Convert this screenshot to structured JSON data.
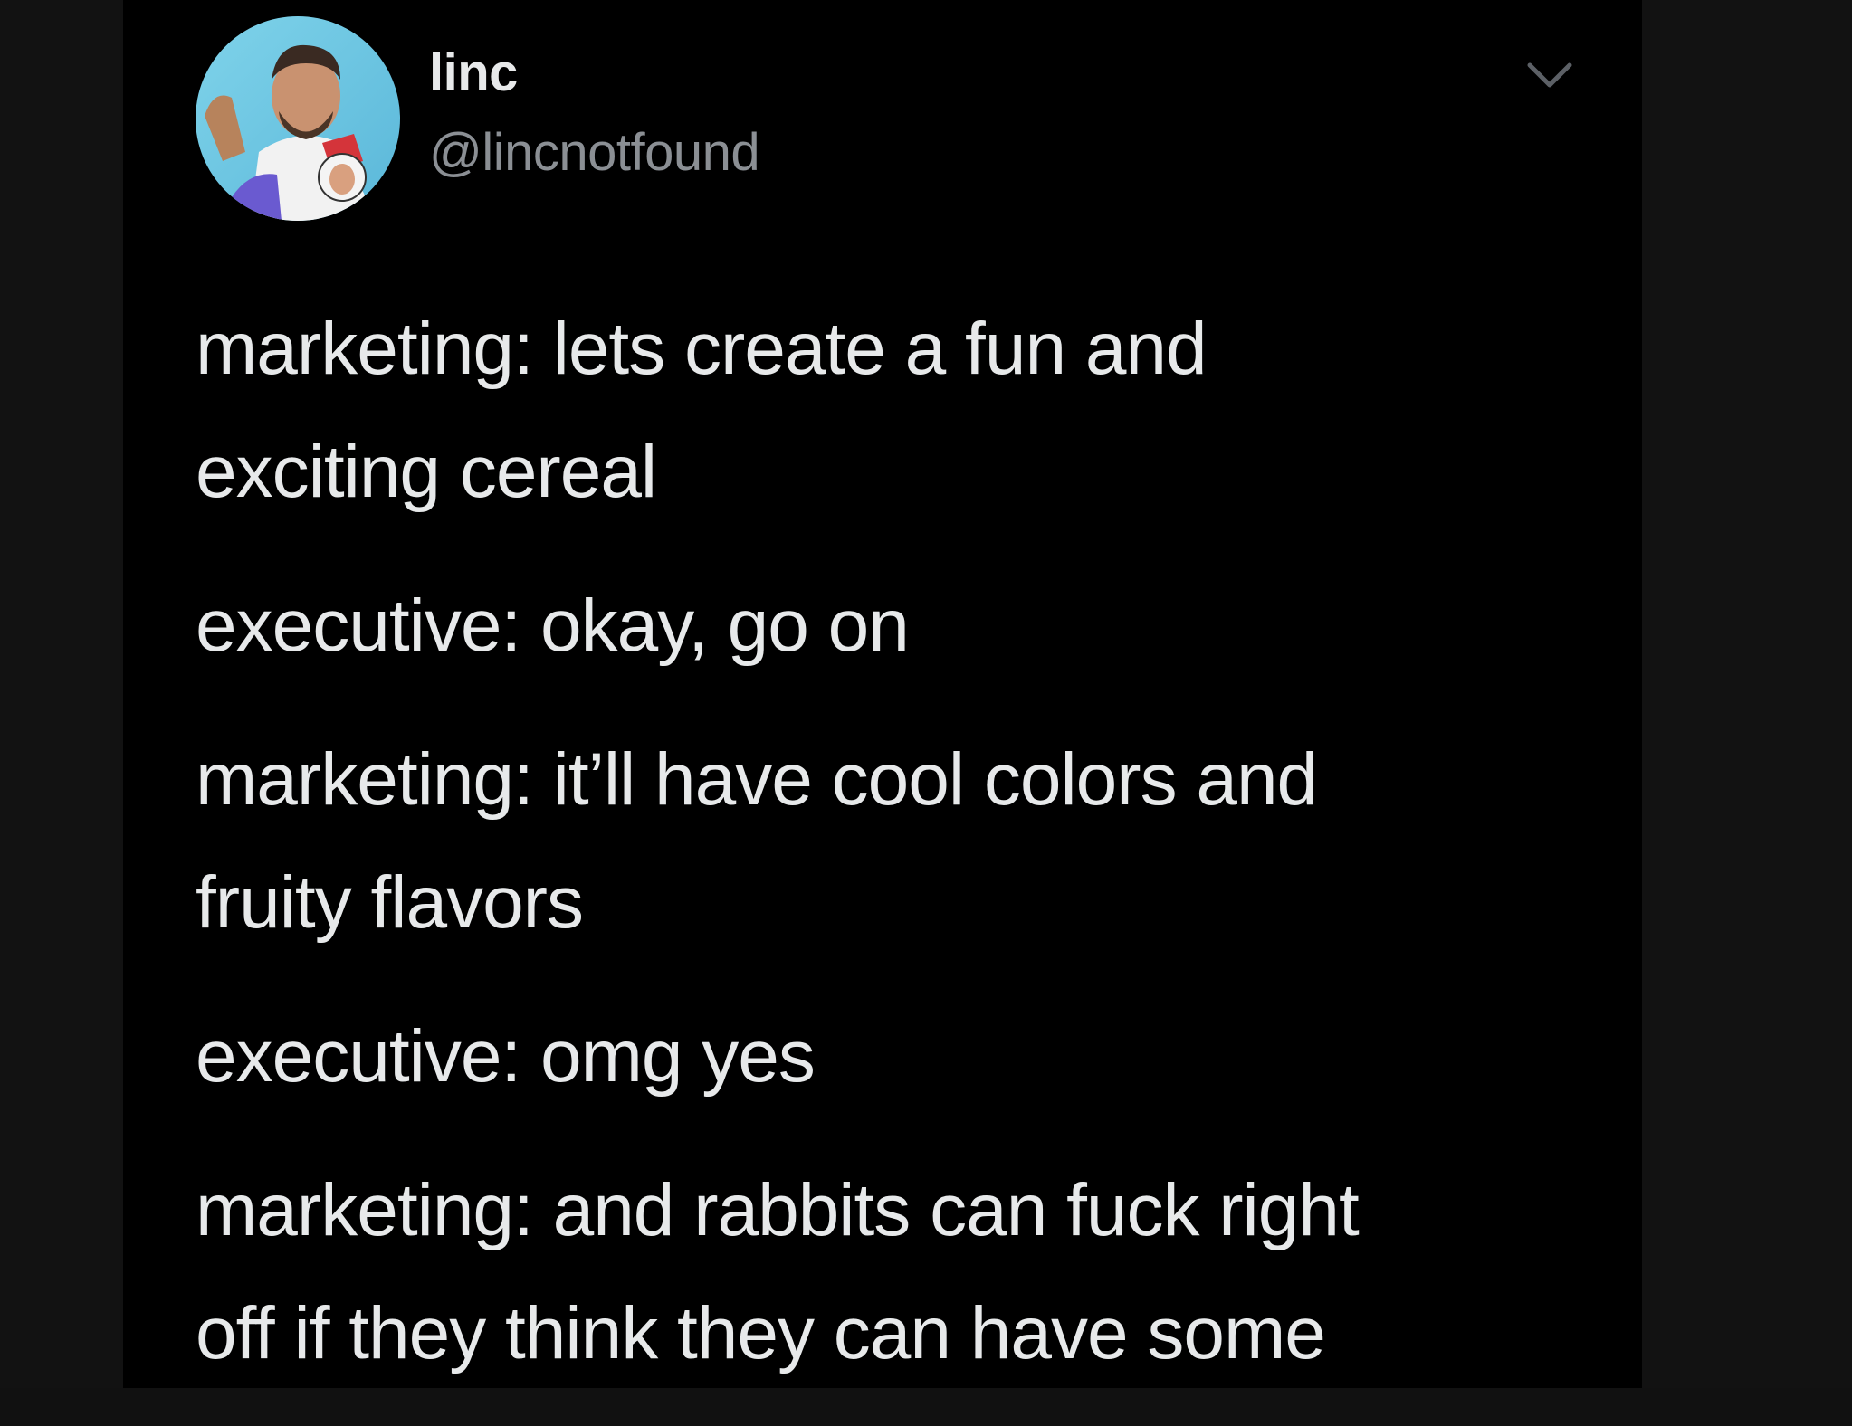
{
  "tweet": {
    "author": {
      "display_name": "linc",
      "handle": "@lincnotfound",
      "avatar_icon": "avatar-image"
    },
    "menu_icon": "chevron-down-icon",
    "paragraphs": [
      "marketing: lets create a fun and\nexciting cereal",
      "executive: okay, go on",
      "marketing: it’ll have cool colors and\nfruity flavors",
      "executive: omg yes",
      "marketing: and rabbits can fuck right\noff if they think they can have some"
    ]
  },
  "colors": {
    "background": "#000000",
    "outer_background": "#121212",
    "text_primary": "#e7e9ea",
    "text_secondary": "#8b8f94"
  }
}
